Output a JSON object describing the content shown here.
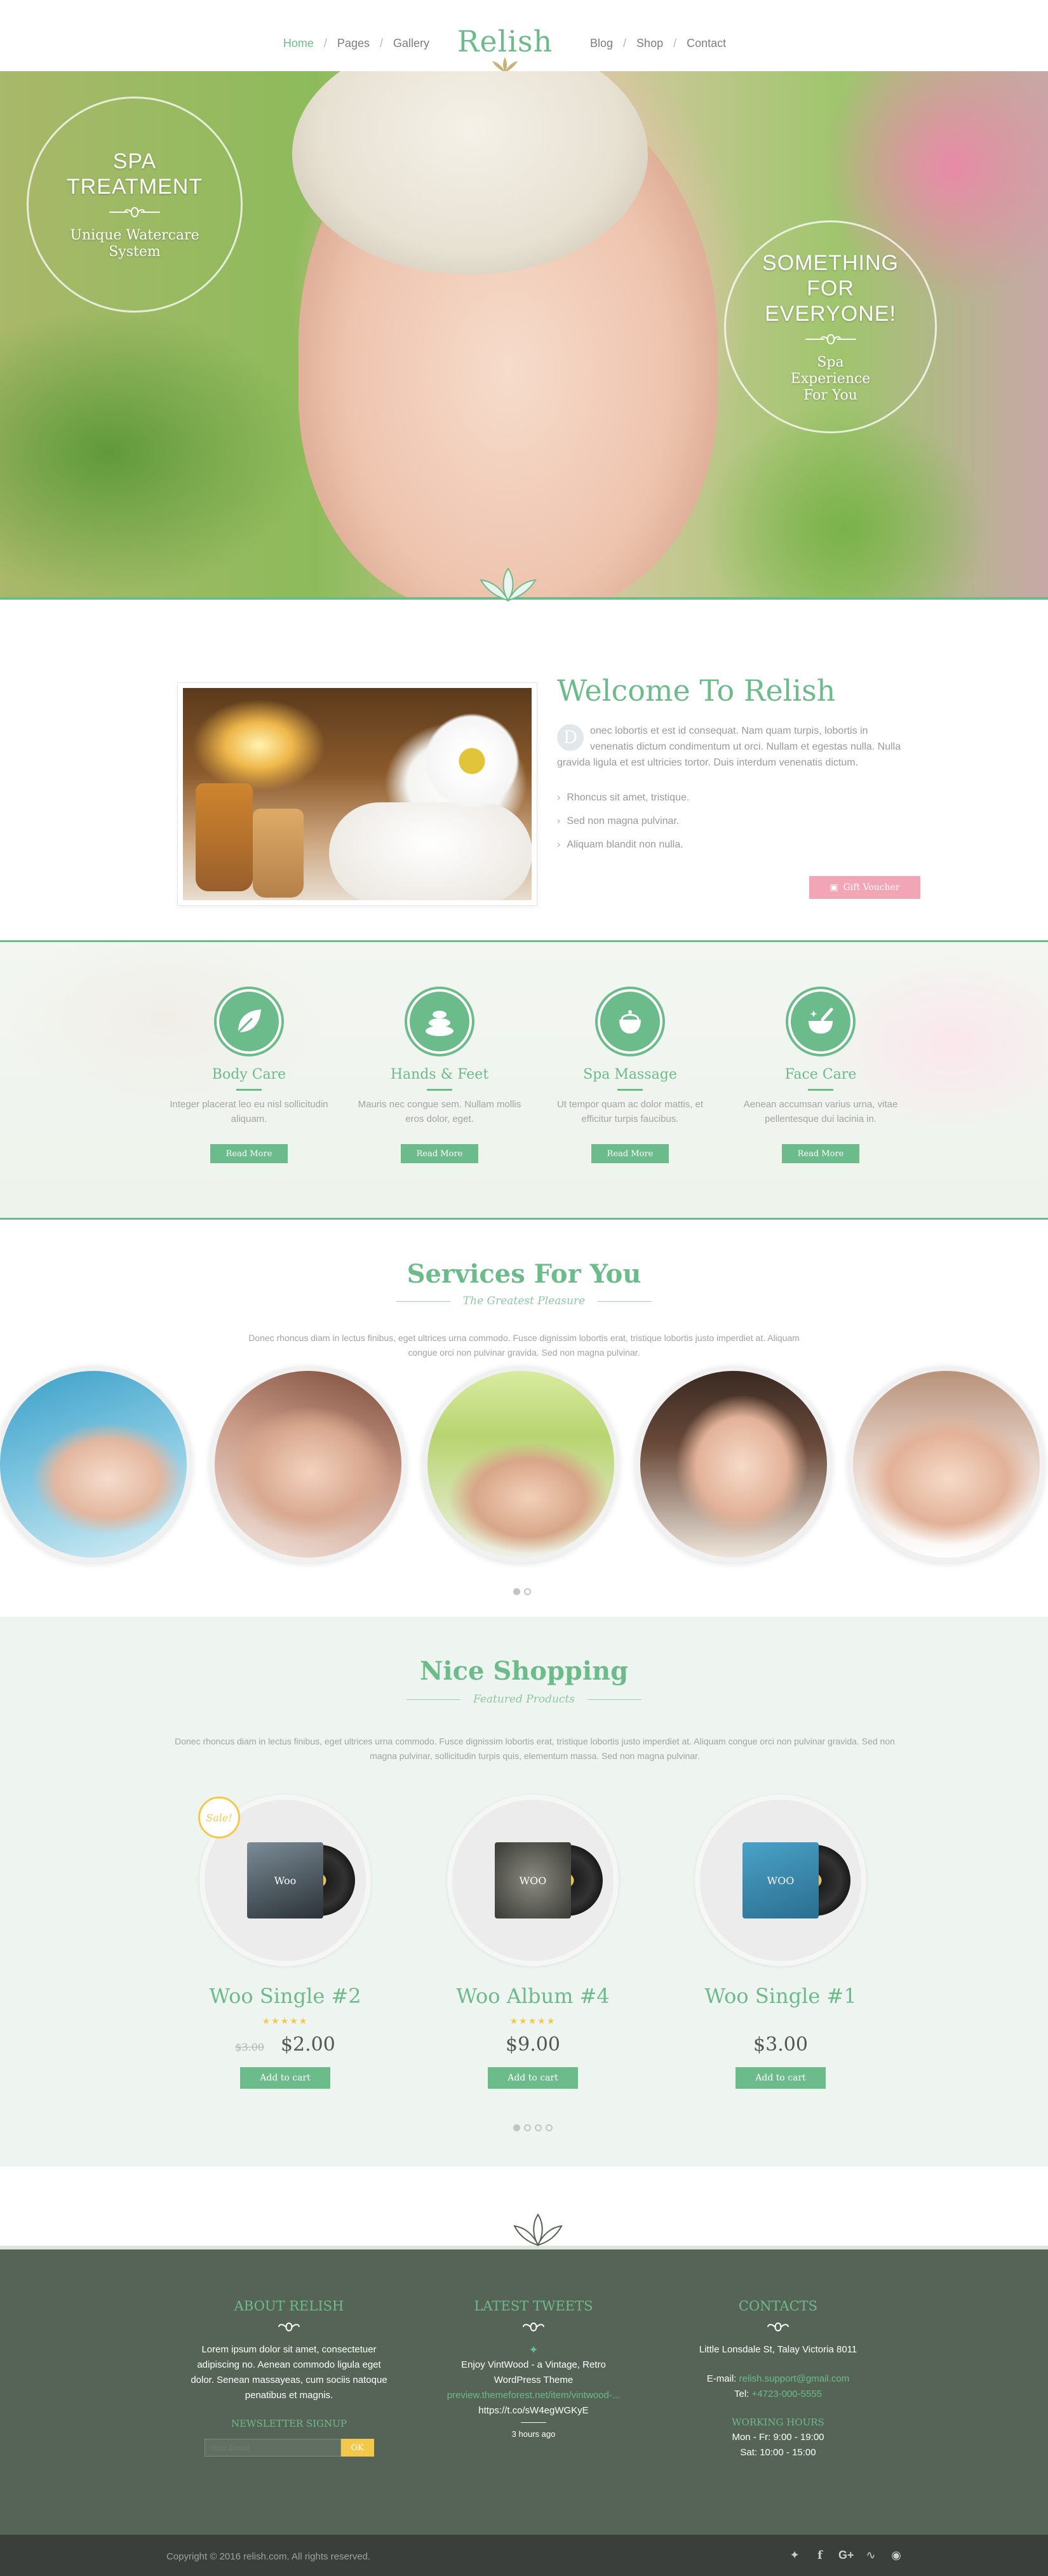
{
  "nav": {
    "left": [
      "Home",
      "Pages",
      "Gallery"
    ],
    "right": [
      "Blog",
      "Shop",
      "Contact"
    ],
    "logo": "Relish"
  },
  "hero": {
    "left_title": "SPA TREATMENT",
    "left_sub": "Unique Watercare System",
    "right_title": "SOMETHING FOR EVERYONE!",
    "right_sub": "Spa Experience For You"
  },
  "welcome": {
    "title": "Welcome To Relish",
    "dropcap": "D",
    "text": "onec lobortis et est id consequat. Nam quam turpis, lobortis in venenatis dictum condimentum ut orci. Nullam et egestas nulla. Nulla gravida ligula et est ultricies tortor. Duis interdum venenatis dictum.",
    "list": [
      "Rhoncus sit amet, tristique.",
      "Sed non magna pulvinar.",
      "Aliquam blandit non nulla."
    ],
    "button": "Gift Voucher"
  },
  "features": [
    {
      "title": "Body Care",
      "text": "Integer placerat leo eu nisl sollicitudin aliquam.",
      "button": "Read More",
      "icon": "leaf-icon"
    },
    {
      "title": "Hands & Feet",
      "text": "Mauris nec congue sem. Nullam mollis eros dolor, eget.",
      "button": "Read More",
      "icon": "stones-icon"
    },
    {
      "title": "Spa Massage",
      "text": "Ut tempor quam ac dolor mattis, et efficitur turpis faucibus.",
      "button": "Read More",
      "icon": "teapot-icon"
    },
    {
      "title": "Face Care",
      "text": "Aenean accumsan varius urna, vitae pellentesque dui lacinia in.",
      "button": "Read More",
      "icon": "mortar-icon"
    }
  ],
  "services": {
    "title": "Services For You",
    "subtitle": "The Greatest Pleasure",
    "text": "Donec rhoncus diam in lectus finibus, eget ultrices urna commodo. Fusce dignissim lobortis erat, tristique lobortis justo imperdiet at. Aliquam congue orci non pulvinar gravida. Sed non magna pulvinar."
  },
  "shop": {
    "title": "Nice Shopping",
    "subtitle": "Featured Products",
    "text": "Donec rhoncus diam in lectus finibus, eget ultrices urna commodo. Fusce dignissim lobortis erat, tristique lobortis justo imperdiet at. Aliquam congue orci non pulvinar gravida. Sed non magna pulvinar, sollicitudin turpis quis, elementum massa. Sed non magna pulvinar.",
    "sale_label": "Sale!",
    "products": [
      {
        "name": "Woo Single #2",
        "old_price": "$3.00",
        "price": "$2.00",
        "stars": "★★★★★",
        "button": "Add to cart",
        "cover": "Woo"
      },
      {
        "name": "Woo Album #4",
        "old_price": "",
        "price": "$9.00",
        "stars": "★★★★★",
        "button": "Add to cart",
        "cover": "WOO"
      },
      {
        "name": "Woo Single #1",
        "old_price": "",
        "price": "$3.00",
        "stars": "",
        "button": "Add to cart",
        "cover": "WOO"
      }
    ]
  },
  "footer": {
    "about_title": "ABOUT RELISH",
    "about_text": "Lorem ipsum dolor sit amet, consectetuer adipiscing no. Aenean commodo ligula eget dolor. Senean massayeas, cum sociis natoque penatibus et magnis.",
    "newsletter_title": "NEWSLETTER SIGNUP",
    "newsletter_placeholder": "Your Email",
    "newsletter_button": "OK",
    "tweets_title": "LATEST TWEETS",
    "tweet_line1": "Enjoy VintWood - a Vintage, Retro WordPress Theme",
    "tweet_link": "preview.themeforest.net/item/vintwood-...",
    "tweet_line3": "https://t.co/sW4egWGKyE",
    "tweet_time": "3 hours ago",
    "contacts_title": "CONTACTS",
    "address": "Little Lonsdale St, Talay Victoria 8011",
    "email_label": "E-mail:",
    "email": "relish.support@gmail.com",
    "tel_label": "Tel:",
    "tel": "+4723-000-5555",
    "hours_title": "WORKING HOURS",
    "hours_weekday": "Mon - Fr: 9:00 - 19:00",
    "hours_sat": "Sat: 10:00 - 15:00",
    "copyright": "Copyright © 2016 relish.com. All rights reserved.",
    "socials": [
      "twitter-icon",
      "facebook-icon",
      "google-plus-icon",
      "rss-icon",
      "instagram-icon"
    ]
  },
  "colors": {
    "accent": "#6cbb8a",
    "pink": "#f2a5b5",
    "gold": "#f4c84a",
    "footer": "#566457"
  }
}
